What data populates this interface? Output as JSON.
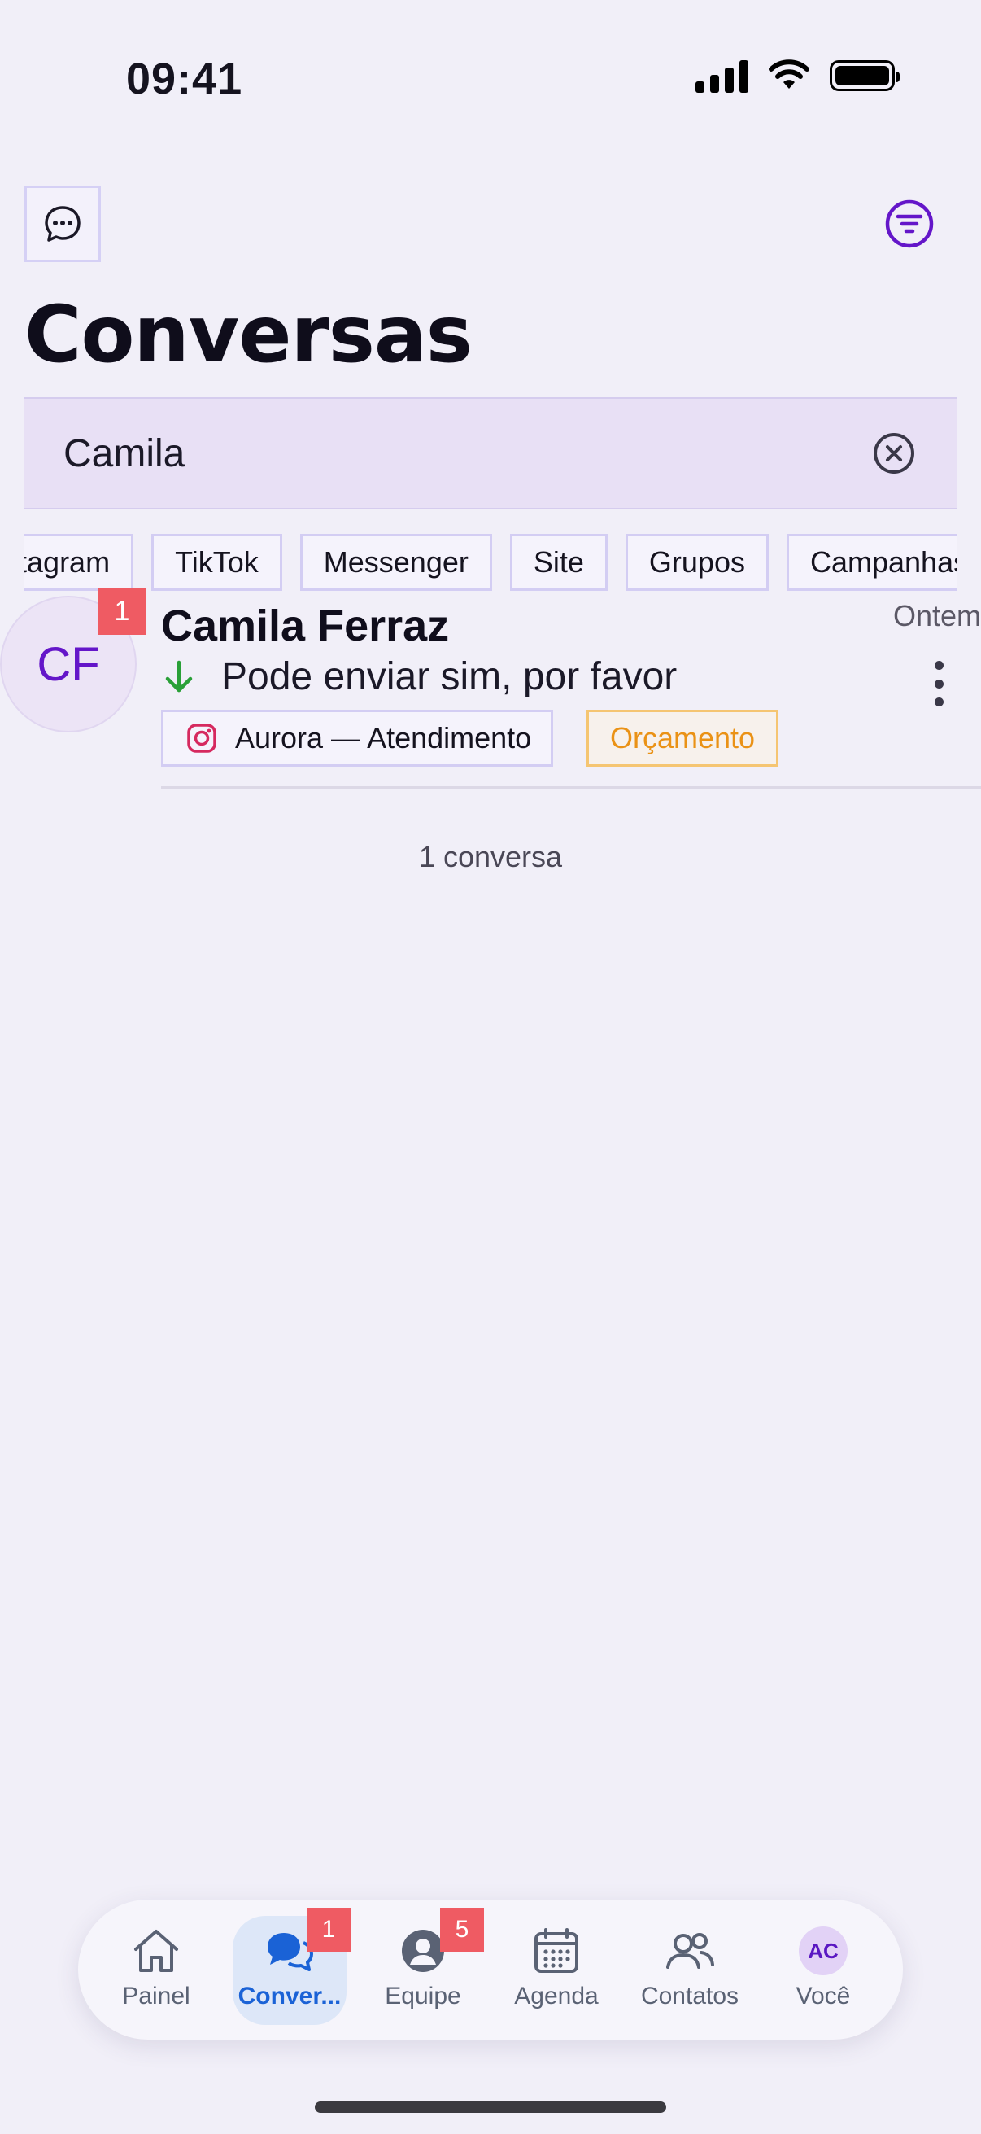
{
  "status_bar": {
    "time": "09:41"
  },
  "header": {
    "title": "Conversas"
  },
  "search": {
    "value": "Camila"
  },
  "channel_filters": [
    "Instagram",
    "TikTok",
    "Messenger",
    "Site",
    "Grupos",
    "Campanhas"
  ],
  "conversation": {
    "initials": "CF",
    "unread": "1",
    "name": "Camila Ferraz",
    "time": "Ontem",
    "last_message": "Pode enviar sim, por favor",
    "inbox": "Aurora — Atendimento",
    "label": "Orçamento"
  },
  "result_count": "1 conversa",
  "tabs": [
    {
      "label": "Painel"
    },
    {
      "label": "Conver...",
      "badge": "1"
    },
    {
      "label": "Equipe",
      "badge": "5"
    },
    {
      "label": "Agenda"
    },
    {
      "label": "Contatos"
    },
    {
      "label": "Você",
      "initials": "AC"
    }
  ],
  "colors": {
    "accent": "#6416c9",
    "active_tab": "#1a62d6",
    "badge": "#ef5b63",
    "label_tag": "#ea9216"
  }
}
